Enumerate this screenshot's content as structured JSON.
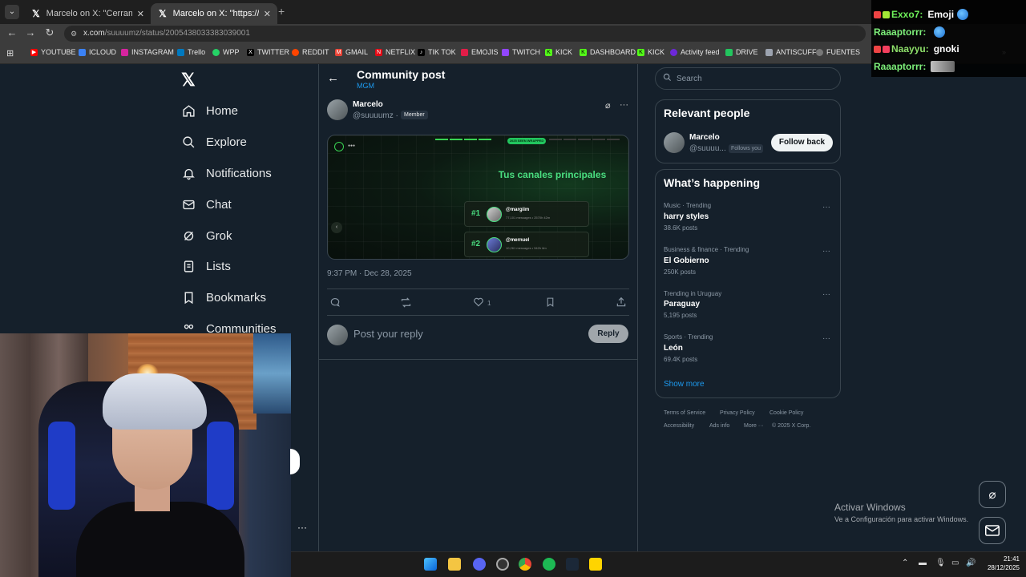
{
  "browser": {
    "tabs": [
      {
        "title": "Marcelo on X: \"Cerramos debat",
        "active": false
      },
      {
        "title": "Marcelo on X: \"https://t.co/CWi",
        "active": true
      }
    ],
    "url_domain": "x.com",
    "url_path": "/suuuumz/status/2005438033383039001",
    "bookmarks": [
      "YOUTUBE",
      "ICLOUD",
      "INSTAGRAM",
      "Trello",
      "WPP",
      "TWITTER",
      "REDDIT",
      "GMAIL",
      "NETFLIX",
      "TIK TOK",
      "EMOJIS",
      "TWITCH",
      "KICK",
      "DASHBOARD",
      "KICK",
      "Activity feed",
      "DRIVE",
      "ANTISCUFF",
      "FUENTES"
    ]
  },
  "nav": {
    "items": [
      "Home",
      "Explore",
      "Notifications",
      "Chat",
      "Grok",
      "Lists",
      "Bookmarks",
      "Communities"
    ]
  },
  "post": {
    "header_title": "Community post",
    "header_sub": "MGM",
    "author_name": "Marcelo",
    "author_handle": "@suuuumz ·",
    "member_badge": "Member",
    "media": {
      "headline": "Tus canales principales",
      "pill": "2025 SEEN WRAPPED",
      "rank1": "#1",
      "user1": "@margiim",
      "stats1": "77,101 messages • 2570h 42m",
      "rank2": "#2",
      "user2": "@mernuel",
      "stats2": "10,261 messages • 542h 6m"
    },
    "timestamp": "9:37 PM · Dec 28, 2025",
    "like_count": "1",
    "reply_placeholder": "Post your reply",
    "reply_button": "Reply"
  },
  "sidebar": {
    "search_placeholder": "Search",
    "relevant_title": "Relevant people",
    "relevant_name": "Marcelo",
    "relevant_handle": "@suuuu...",
    "follows_you": "Follows you",
    "follow_back": "Follow back",
    "happening_title": "What’s happening",
    "trends": [
      {
        "category": "Music · Trending",
        "name": "harry styles",
        "posts": "38.6K posts"
      },
      {
        "category": "Business & finance · Trending",
        "name": "El Gobierno",
        "posts": "250K posts"
      },
      {
        "category": "Trending in Uruguay",
        "name": "Paraguay",
        "posts": "5,195 posts"
      },
      {
        "category": "Sports · Trending",
        "name": "León",
        "posts": "69.4K posts"
      }
    ],
    "show_more": "Show more",
    "footer": [
      "Terms of Service",
      "Privacy Policy",
      "Cookie Policy",
      "Accessibility",
      "Ads info",
      "More ···",
      "© 2025 X Corp."
    ]
  },
  "chat_overlay": {
    "lines": [
      {
        "user": "Exxo7:",
        "message": "Emoji"
      },
      {
        "user": "Raaaptorrr:",
        "message": ""
      },
      {
        "user": "Naayyu:",
        "message": "gnoki"
      },
      {
        "user": "Raaaptorrr:",
        "message": ""
      }
    ]
  },
  "windows": {
    "activate_title": "Activar Windows",
    "activate_sub": "Ve a Configuración para activar Windows.",
    "time": "21:41",
    "date": "28/12/2025"
  },
  "colors": {
    "background": "#15202b",
    "accent": "#1d9bf0",
    "media_green": "#4ade80"
  }
}
